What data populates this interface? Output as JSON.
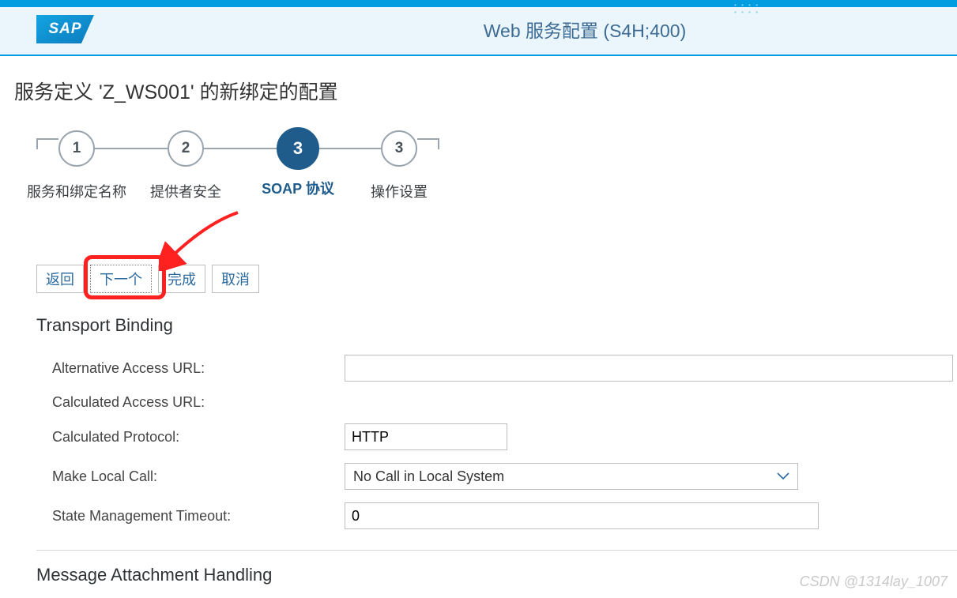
{
  "header": {
    "logo_text": "SAP",
    "title": "Web 服务配置 (S4H;400)"
  },
  "page": {
    "title": "服务定义 'Z_WS001' 的新绑定的配置"
  },
  "wizard": {
    "steps": [
      {
        "num": "1",
        "label": "服务和绑定名称",
        "active": false
      },
      {
        "num": "2",
        "label": "提供者安全",
        "active": false
      },
      {
        "num": "3",
        "label": "SOAP 协议",
        "active": true
      },
      {
        "num": "3",
        "label": "操作设置",
        "active": false
      }
    ]
  },
  "buttons": {
    "back": "返回",
    "next": "下一个",
    "finish": "完成",
    "cancel": "取消"
  },
  "section1": {
    "title": "Transport Binding",
    "alt_url_label": "Alternative Access URL:",
    "alt_url_value": "",
    "calc_url_label": "Calculated Access URL:",
    "calc_url_value": "",
    "protocol_label": "Calculated Protocol:",
    "protocol_value": "HTTP",
    "local_call_label": "Make Local Call:",
    "local_call_value": "No Call in Local System",
    "timeout_label": "State Management Timeout:",
    "timeout_value": "0"
  },
  "section2": {
    "title": "Message Attachment Handling"
  },
  "watermark": "CSDN @1314lay_1007"
}
